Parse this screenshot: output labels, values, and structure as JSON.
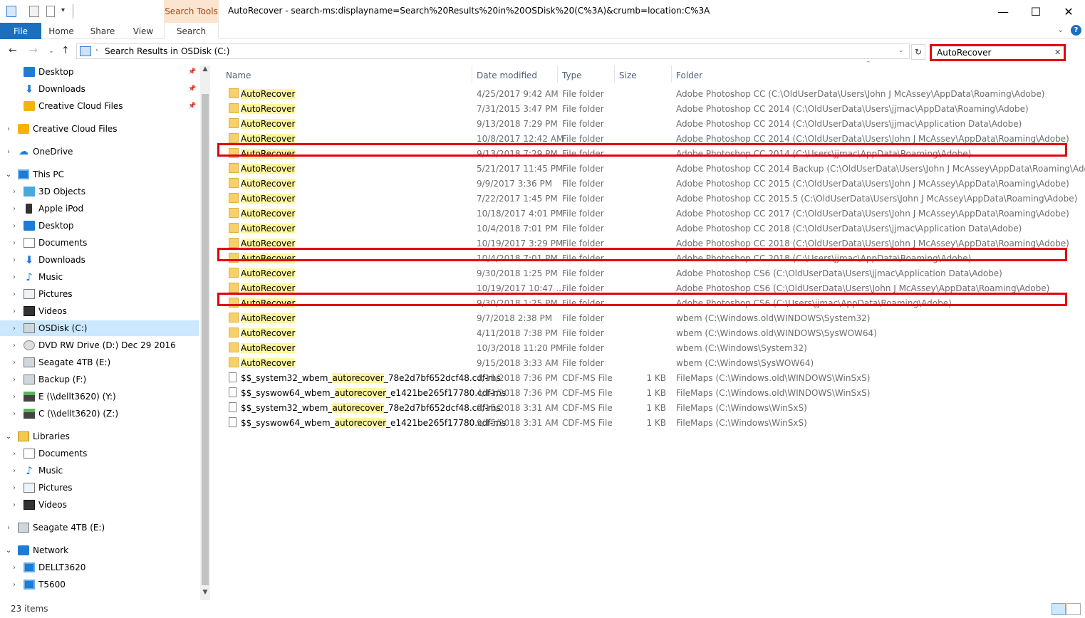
{
  "window": {
    "title": "AutoRecover - search-ms:displayname=Search%20Results%20in%20OSDisk%20(C%3A)&crumb=location:C%3A",
    "context_tab": "Search Tools",
    "minimize": "—",
    "maximize": "☐",
    "close": "✕"
  },
  "ribbon": {
    "tabs": [
      "File",
      "Home",
      "Share",
      "View",
      "Search"
    ],
    "expand": "⌄",
    "help": "?"
  },
  "nav": {
    "back": "←",
    "forward": "→",
    "recent": "⌄",
    "up": "↑"
  },
  "address": {
    "separator": "›",
    "path": "Search Results in OSDisk (C:)",
    "dropdown": "⌄",
    "refresh": "↻"
  },
  "search": {
    "value": "AutoRecover",
    "clear": "✕"
  },
  "sidebar": {
    "items": [
      {
        "label": "Desktop",
        "icon": "desktop-icon",
        "pinned": true
      },
      {
        "label": "Downloads",
        "icon": "downloads-icon",
        "pinned": true
      },
      {
        "label": "Creative Cloud Files",
        "icon": "creative-cloud-icon",
        "pinned": true
      },
      {
        "label": "Creative Cloud Files",
        "icon": "creative-cloud-icon"
      },
      {
        "label": "OneDrive",
        "icon": "onedrive-icon"
      },
      {
        "label": "This PC",
        "icon": "pc-icon"
      },
      {
        "label": "3D Objects",
        "icon": "3d-objects-icon"
      },
      {
        "label": "Apple iPod",
        "icon": "ipod-icon"
      },
      {
        "label": "Desktop",
        "icon": "desktop-icon"
      },
      {
        "label": "Documents",
        "icon": "documents-icon"
      },
      {
        "label": "Downloads",
        "icon": "downloads-icon"
      },
      {
        "label": "Music",
        "icon": "music-icon"
      },
      {
        "label": "Pictures",
        "icon": "pictures-icon"
      },
      {
        "label": "Videos",
        "icon": "videos-icon"
      },
      {
        "label": "OSDisk (C:)",
        "icon": "drive-icon",
        "selected": true
      },
      {
        "label": "DVD RW Drive (D:) Dec 29 2016",
        "icon": "dvd-icon"
      },
      {
        "label": "Seagate 4TB (E:)",
        "icon": "drive-icon"
      },
      {
        "label": "Backup (F:)",
        "icon": "drive-icon"
      },
      {
        "label": "E (\\\\dellt3620) (Y:)",
        "icon": "network-drive-icon"
      },
      {
        "label": "C (\\\\dellt3620) (Z:)",
        "icon": "network-drive-icon"
      },
      {
        "label": "Libraries",
        "icon": "libraries-icon"
      },
      {
        "label": "Documents",
        "icon": "documents-icon"
      },
      {
        "label": "Music",
        "icon": "music-icon"
      },
      {
        "label": "Pictures",
        "icon": "pictures-icon"
      },
      {
        "label": "Videos",
        "icon": "videos-icon"
      },
      {
        "label": "Seagate 4TB (E:)",
        "icon": "drive-icon"
      },
      {
        "label": "Network",
        "icon": "network-icon"
      },
      {
        "label": "DELLT3620",
        "icon": "computer-icon"
      },
      {
        "label": "T5600",
        "icon": "computer-icon"
      }
    ]
  },
  "columns": {
    "name": "Name",
    "date": "Date modified",
    "type": "Type",
    "size": "Size",
    "folder": "Folder"
  },
  "files": [
    {
      "pre": "",
      "hl": "AutoRecover",
      "post": "",
      "date": "4/25/2017 9:42 AM",
      "type": "File folder",
      "size": "",
      "folder": "Adobe Photoshop CC (C:\\OldUserData\\Users\\John J McAssey\\AppData\\Roaming\\Adobe)"
    },
    {
      "pre": "",
      "hl": "AutoRecover",
      "post": "",
      "date": "7/31/2015 3:47 PM",
      "type": "File folder",
      "size": "",
      "folder": "Adobe Photoshop CC 2014 (C:\\OldUserData\\Users\\jjmac\\AppData\\Roaming\\Adobe)"
    },
    {
      "pre": "",
      "hl": "AutoRecover",
      "post": "",
      "date": "9/13/2018 7:29 PM",
      "type": "File folder",
      "size": "",
      "folder": "Adobe Photoshop CC 2014 (C:\\OldUserData\\Users\\jjmac\\Application Data\\Adobe)"
    },
    {
      "pre": "",
      "hl": "AutoRecover",
      "post": "",
      "date": "10/8/2017 12:42 AM",
      "type": "File folder",
      "size": "",
      "folder": "Adobe Photoshop CC 2014 (C:\\OldUserData\\Users\\John J McAssey\\AppData\\Roaming\\Adobe)"
    },
    {
      "pre": "",
      "hl": "AutoRecover",
      "post": "",
      "date": "9/13/2018 7:29 PM",
      "type": "File folder",
      "size": "",
      "folder": "Adobe Photoshop CC 2014 (C:\\Users\\jjmac\\AppData\\Roaming\\Adobe)",
      "marked": true
    },
    {
      "pre": "",
      "hl": "AutoRecover",
      "post": "",
      "date": "5/21/2017 11:45 PM",
      "type": "File folder",
      "size": "",
      "folder": "Adobe Photoshop CC 2014 Backup (C:\\OldUserData\\Users\\John J McAssey\\AppData\\Roaming\\Adobe)"
    },
    {
      "pre": "",
      "hl": "AutoRecover",
      "post": "",
      "date": "9/9/2017 3:36 PM",
      "type": "File folder",
      "size": "",
      "folder": "Adobe Photoshop CC 2015 (C:\\OldUserData\\Users\\John J McAssey\\AppData\\Roaming\\Adobe)"
    },
    {
      "pre": "",
      "hl": "AutoRecover",
      "post": "",
      "date": "7/22/2017 1:45 PM",
      "type": "File folder",
      "size": "",
      "folder": "Adobe Photoshop CC 2015.5 (C:\\OldUserData\\Users\\John J McAssey\\AppData\\Roaming\\Adobe)"
    },
    {
      "pre": "",
      "hl": "AutoRecover",
      "post": "",
      "date": "10/18/2017 4:01 PM",
      "type": "File folder",
      "size": "",
      "folder": "Adobe Photoshop CC 2017 (C:\\OldUserData\\Users\\John J McAssey\\AppData\\Roaming\\Adobe)"
    },
    {
      "pre": "",
      "hl": "AutoRecover",
      "post": "",
      "date": "10/4/2018 7:01 PM",
      "type": "File folder",
      "size": "",
      "folder": "Adobe Photoshop CC 2018 (C:\\OldUserData\\Users\\jjmac\\Application Data\\Adobe)"
    },
    {
      "pre": "",
      "hl": "AutoRecover",
      "post": "",
      "date": "10/19/2017 3:29 PM",
      "type": "File folder",
      "size": "",
      "folder": "Adobe Photoshop CC 2018 (C:\\OldUserData\\Users\\John J McAssey\\AppData\\Roaming\\Adobe)"
    },
    {
      "pre": "",
      "hl": "AutoRecover",
      "post": "",
      "date": "10/4/2018 7:01 PM",
      "type": "File folder",
      "size": "",
      "folder": "Adobe Photoshop CC 2018 (C:\\Users\\jjmac\\AppData\\Roaming\\Adobe)",
      "marked": true
    },
    {
      "pre": "",
      "hl": "AutoRecover",
      "post": "",
      "date": "9/30/2018 1:25 PM",
      "type": "File folder",
      "size": "",
      "folder": "Adobe Photoshop CS6 (C:\\OldUserData\\Users\\jjmac\\Application Data\\Adobe)"
    },
    {
      "pre": "",
      "hl": "AutoRecover",
      "post": "",
      "date": "10/19/2017 10:47 ...",
      "type": "File folder",
      "size": "",
      "folder": "Adobe Photoshop CS6 (C:\\OldUserData\\Users\\John J McAssey\\AppData\\Roaming\\Adobe)"
    },
    {
      "pre": "",
      "hl": "AutoRecover",
      "post": "",
      "date": "9/30/2018 1:25 PM",
      "type": "File folder",
      "size": "",
      "folder": "Adobe Photoshop CS6 (C:\\Users\\jjmac\\AppData\\Roaming\\Adobe)",
      "marked": true
    },
    {
      "pre": "",
      "hl": "AutoRecover",
      "post": "",
      "date": "9/7/2018 2:38 PM",
      "type": "File folder",
      "size": "",
      "folder": "wbem (C:\\Windows.old\\WINDOWS\\System32)"
    },
    {
      "pre": "",
      "hl": "AutoRecover",
      "post": "",
      "date": "4/11/2018 7:38 PM",
      "type": "File folder",
      "size": "",
      "folder": "wbem (C:\\Windows.old\\WINDOWS\\SysWOW64)"
    },
    {
      "pre": "",
      "hl": "AutoRecover",
      "post": "",
      "date": "10/3/2018 11:20 PM",
      "type": "File folder",
      "size": "",
      "folder": "wbem (C:\\Windows\\System32)"
    },
    {
      "pre": "",
      "hl": "AutoRecover",
      "post": "",
      "date": "9/15/2018 3:33 AM",
      "type": "File folder",
      "size": "",
      "folder": "wbem (C:\\Windows\\SysWOW64)"
    },
    {
      "pre": "$$_system32_wbem_",
      "hl": "autorecover",
      "post": "_78e2d7bf652dcf48.cdf-ms",
      "date": "4/11/2018 7:36 PM",
      "type": "CDF-MS File",
      "size": "1 KB",
      "folder": "FileMaps (C:\\Windows.old\\WINDOWS\\WinSxS)",
      "is_file": true
    },
    {
      "pre": "$$_syswow64_wbem_",
      "hl": "autorecover",
      "post": "_e1421be265f17780.cdf-ms",
      "date": "4/11/2018 7:36 PM",
      "type": "CDF-MS File",
      "size": "1 KB",
      "folder": "FileMaps (C:\\Windows.old\\WINDOWS\\WinSxS)",
      "is_file": true
    },
    {
      "pre": "$$_system32_wbem_",
      "hl": "autorecover",
      "post": "_78e2d7bf652dcf48.cdf-ms",
      "date": "9/15/2018 3:31 AM",
      "type": "CDF-MS File",
      "size": "1 KB",
      "folder": "FileMaps (C:\\Windows\\WinSxS)",
      "is_file": true
    },
    {
      "pre": "$$_syswow64_wbem_",
      "hl": "autorecover",
      "post": "_e1421be265f17780.cdf-ms",
      "date": "9/15/2018 3:31 AM",
      "type": "CDF-MS File",
      "size": "1 KB",
      "folder": "FileMaps (C:\\Windows\\WinSxS)",
      "is_file": true
    }
  ],
  "status": {
    "count": "23 items"
  },
  "colors": {
    "highlight": "#fff59d",
    "annotation_red": "#e3000f",
    "selected_bg": "#cce8ff",
    "file_tab": "#1a6fbe"
  }
}
